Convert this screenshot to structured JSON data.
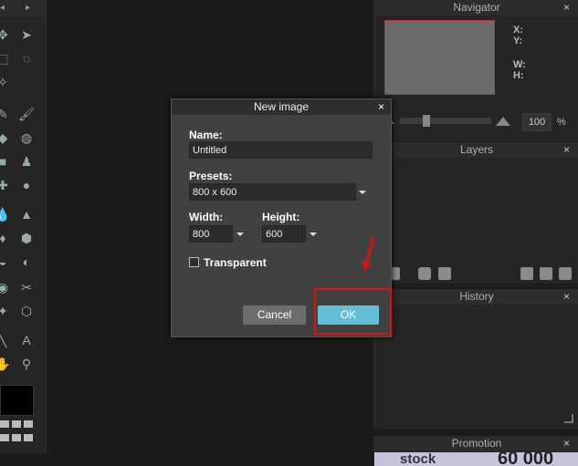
{
  "dialog": {
    "title": "New image",
    "close_label": "×",
    "name_label": "Name:",
    "name_value": "Untitled",
    "presets_label": "Presets:",
    "preset_value": "800 x 600",
    "width_label": "Width:",
    "width_value": "800",
    "height_label": "Height:",
    "height_value": "600",
    "transparent_label": "Transparent",
    "cancel_label": "Cancel",
    "ok_label": "OK"
  },
  "navigator": {
    "title": "Navigator",
    "close_label": "×",
    "x_label": "X:",
    "y_label": "Y:",
    "w_label": "W:",
    "h_label": "H:",
    "zoom_value": "100",
    "zoom_unit": "%"
  },
  "layers": {
    "title": "Layers",
    "close_label": "×"
  },
  "history": {
    "title": "History",
    "close_label": "×"
  },
  "promotion": {
    "title": "Promotion",
    "close_label": "×",
    "brand": "stock",
    "number": "60 000"
  },
  "toolbar": {
    "collapse_left": "◂",
    "collapse_right": "▸"
  },
  "colors": {
    "accent": "#63bfd8",
    "highlight": "#e01010",
    "panel": "#252525",
    "dialog": "#414141"
  }
}
